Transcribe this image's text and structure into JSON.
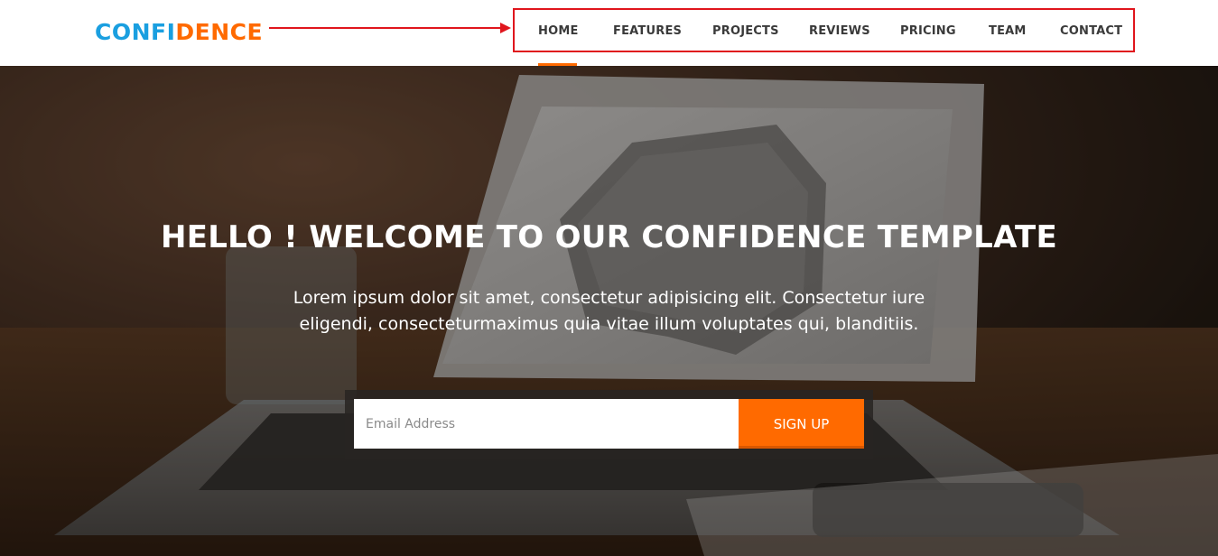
{
  "brand": {
    "part1": "CONFI",
    "part2": "DENCE",
    "color1": "#1a9fe0",
    "color2": "#ff6a00"
  },
  "nav": {
    "active": "HOME",
    "items": [
      {
        "label": "HOME"
      },
      {
        "label": "FEATURES"
      },
      {
        "label": "PROJECTS"
      },
      {
        "label": "REVIEWS"
      },
      {
        "label": "PRICING"
      },
      {
        "label": "TEAM"
      },
      {
        "label": "CONTACT"
      }
    ]
  },
  "annotation": {
    "color": "#e0161d",
    "target": "nav-menu"
  },
  "hero": {
    "headline": "HELLO ! WELCOME TO OUR CONFIDENCE TEMPLATE",
    "subtext": "Lorem ipsum dolor sit amet, consectetur adipisicing elit. Consectetur iure eligendi, consecteturmaximus quia vitae illum voluptates qui, blanditiis.",
    "background": "laptop-on-desk-photo"
  },
  "signup": {
    "email_placeholder": "Email Address",
    "email_value": "",
    "button_label": "SIGN UP",
    "button_color": "#ff6a00"
  }
}
